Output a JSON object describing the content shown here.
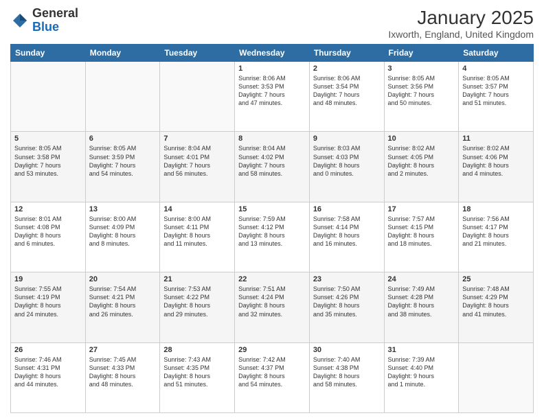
{
  "header": {
    "logo_general": "General",
    "logo_blue": "Blue",
    "title": "January 2025",
    "subtitle": "Ixworth, England, United Kingdom"
  },
  "weekdays": [
    "Sunday",
    "Monday",
    "Tuesday",
    "Wednesday",
    "Thursday",
    "Friday",
    "Saturday"
  ],
  "weeks": [
    [
      {
        "num": "",
        "info": ""
      },
      {
        "num": "",
        "info": ""
      },
      {
        "num": "",
        "info": ""
      },
      {
        "num": "1",
        "info": "Sunrise: 8:06 AM\nSunset: 3:53 PM\nDaylight: 7 hours\nand 47 minutes."
      },
      {
        "num": "2",
        "info": "Sunrise: 8:06 AM\nSunset: 3:54 PM\nDaylight: 7 hours\nand 48 minutes."
      },
      {
        "num": "3",
        "info": "Sunrise: 8:05 AM\nSunset: 3:56 PM\nDaylight: 7 hours\nand 50 minutes."
      },
      {
        "num": "4",
        "info": "Sunrise: 8:05 AM\nSunset: 3:57 PM\nDaylight: 7 hours\nand 51 minutes."
      }
    ],
    [
      {
        "num": "5",
        "info": "Sunrise: 8:05 AM\nSunset: 3:58 PM\nDaylight: 7 hours\nand 53 minutes."
      },
      {
        "num": "6",
        "info": "Sunrise: 8:05 AM\nSunset: 3:59 PM\nDaylight: 7 hours\nand 54 minutes."
      },
      {
        "num": "7",
        "info": "Sunrise: 8:04 AM\nSunset: 4:01 PM\nDaylight: 7 hours\nand 56 minutes."
      },
      {
        "num": "8",
        "info": "Sunrise: 8:04 AM\nSunset: 4:02 PM\nDaylight: 7 hours\nand 58 minutes."
      },
      {
        "num": "9",
        "info": "Sunrise: 8:03 AM\nSunset: 4:03 PM\nDaylight: 8 hours\nand 0 minutes."
      },
      {
        "num": "10",
        "info": "Sunrise: 8:02 AM\nSunset: 4:05 PM\nDaylight: 8 hours\nand 2 minutes."
      },
      {
        "num": "11",
        "info": "Sunrise: 8:02 AM\nSunset: 4:06 PM\nDaylight: 8 hours\nand 4 minutes."
      }
    ],
    [
      {
        "num": "12",
        "info": "Sunrise: 8:01 AM\nSunset: 4:08 PM\nDaylight: 8 hours\nand 6 minutes."
      },
      {
        "num": "13",
        "info": "Sunrise: 8:00 AM\nSunset: 4:09 PM\nDaylight: 8 hours\nand 8 minutes."
      },
      {
        "num": "14",
        "info": "Sunrise: 8:00 AM\nSunset: 4:11 PM\nDaylight: 8 hours\nand 11 minutes."
      },
      {
        "num": "15",
        "info": "Sunrise: 7:59 AM\nSunset: 4:12 PM\nDaylight: 8 hours\nand 13 minutes."
      },
      {
        "num": "16",
        "info": "Sunrise: 7:58 AM\nSunset: 4:14 PM\nDaylight: 8 hours\nand 16 minutes."
      },
      {
        "num": "17",
        "info": "Sunrise: 7:57 AM\nSunset: 4:15 PM\nDaylight: 8 hours\nand 18 minutes."
      },
      {
        "num": "18",
        "info": "Sunrise: 7:56 AM\nSunset: 4:17 PM\nDaylight: 8 hours\nand 21 minutes."
      }
    ],
    [
      {
        "num": "19",
        "info": "Sunrise: 7:55 AM\nSunset: 4:19 PM\nDaylight: 8 hours\nand 24 minutes."
      },
      {
        "num": "20",
        "info": "Sunrise: 7:54 AM\nSunset: 4:21 PM\nDaylight: 8 hours\nand 26 minutes."
      },
      {
        "num": "21",
        "info": "Sunrise: 7:53 AM\nSunset: 4:22 PM\nDaylight: 8 hours\nand 29 minutes."
      },
      {
        "num": "22",
        "info": "Sunrise: 7:51 AM\nSunset: 4:24 PM\nDaylight: 8 hours\nand 32 minutes."
      },
      {
        "num": "23",
        "info": "Sunrise: 7:50 AM\nSunset: 4:26 PM\nDaylight: 8 hours\nand 35 minutes."
      },
      {
        "num": "24",
        "info": "Sunrise: 7:49 AM\nSunset: 4:28 PM\nDaylight: 8 hours\nand 38 minutes."
      },
      {
        "num": "25",
        "info": "Sunrise: 7:48 AM\nSunset: 4:29 PM\nDaylight: 8 hours\nand 41 minutes."
      }
    ],
    [
      {
        "num": "26",
        "info": "Sunrise: 7:46 AM\nSunset: 4:31 PM\nDaylight: 8 hours\nand 44 minutes."
      },
      {
        "num": "27",
        "info": "Sunrise: 7:45 AM\nSunset: 4:33 PM\nDaylight: 8 hours\nand 48 minutes."
      },
      {
        "num": "28",
        "info": "Sunrise: 7:43 AM\nSunset: 4:35 PM\nDaylight: 8 hours\nand 51 minutes."
      },
      {
        "num": "29",
        "info": "Sunrise: 7:42 AM\nSunset: 4:37 PM\nDaylight: 8 hours\nand 54 minutes."
      },
      {
        "num": "30",
        "info": "Sunrise: 7:40 AM\nSunset: 4:38 PM\nDaylight: 8 hours\nand 58 minutes."
      },
      {
        "num": "31",
        "info": "Sunrise: 7:39 AM\nSunset: 4:40 PM\nDaylight: 9 hours\nand 1 minute."
      },
      {
        "num": "",
        "info": ""
      }
    ]
  ]
}
